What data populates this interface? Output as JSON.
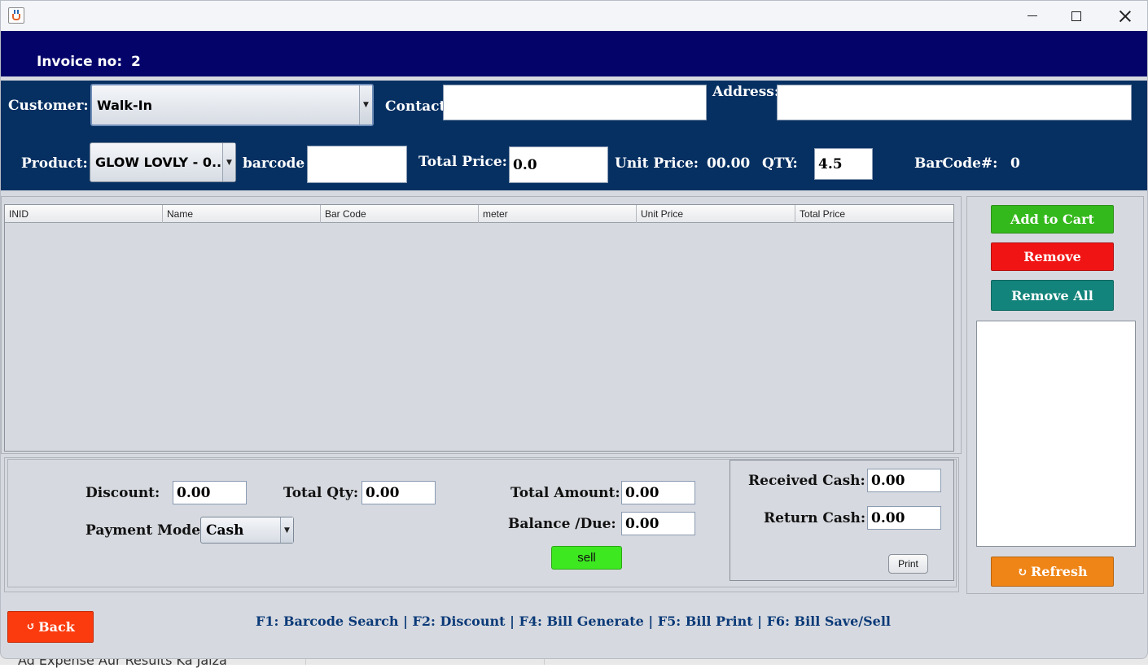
{
  "background": {
    "text": "Ad Expense Aur Results Ka Jaiza"
  },
  "titlebar": {
    "app_icon": "java-cup-icon",
    "minimize_icon": "minimize-icon",
    "maximize_icon": "maximize-icon",
    "close_icon": "close-icon"
  },
  "invoice": {
    "label": "Invoice no:",
    "value": "2"
  },
  "form": {
    "customer_label": "Customer:",
    "customer_value": "Walk-In",
    "contact_label": "Contact:",
    "contact_value": "",
    "address_label": "Address:",
    "address_value": "",
    "product_label": "Product:",
    "product_value": "GLOW LOVLY - 0...",
    "barcode_label": "barcode",
    "barcode_value": "",
    "total_price_label": "Total Price:",
    "total_price_value": "0.0",
    "unit_price_label": "Unit Price:",
    "unit_price_value": "00.00",
    "qty_label": "QTY:",
    "qty_value": "4.5",
    "barcode_num_label": "BarCode#:",
    "barcode_num_value": "0"
  },
  "table": {
    "columns": [
      "INID",
      "Name",
      "Bar Code",
      "meter",
      "Unit Price",
      "Total Price"
    ],
    "rows": []
  },
  "actions": {
    "add_to_cart": "Add to Cart",
    "remove": "Remove",
    "remove_all": "Remove All",
    "refresh": "Refresh"
  },
  "summary": {
    "discount_label": "Discount:",
    "discount_value": "0.00",
    "total_qty_label": "Total Qty:",
    "total_qty_value": "0.00",
    "payment_mode_label": "Payment Mode:",
    "payment_mode_value": "Cash",
    "total_amount_label": "Total Amount:",
    "total_amount_value": "0.00",
    "balance_due_label": "Balance /Due:",
    "balance_due_value": "0.00",
    "sell_label": "sell",
    "received_cash_label": "Received Cash:",
    "received_cash_value": "0.00",
    "return_cash_label": "Return Cash:",
    "return_cash_value": "0.00",
    "print_label": "Print"
  },
  "footer": {
    "back_label": "Back",
    "shortcuts": "F1: Barcode Search  |  F2: Discount  |  F4: Bill Generate  |  F5: Bill Print  |  F6: Bill Save/Sell"
  },
  "colors": {
    "invoice_bar": "#04036a",
    "form_panel": "#063062",
    "add_to_cart": "#34b91c",
    "remove": "#f01514",
    "remove_all": "#13847b",
    "refresh": "#ef8517",
    "sell": "#3ee821",
    "back": "#fb3a0d"
  }
}
